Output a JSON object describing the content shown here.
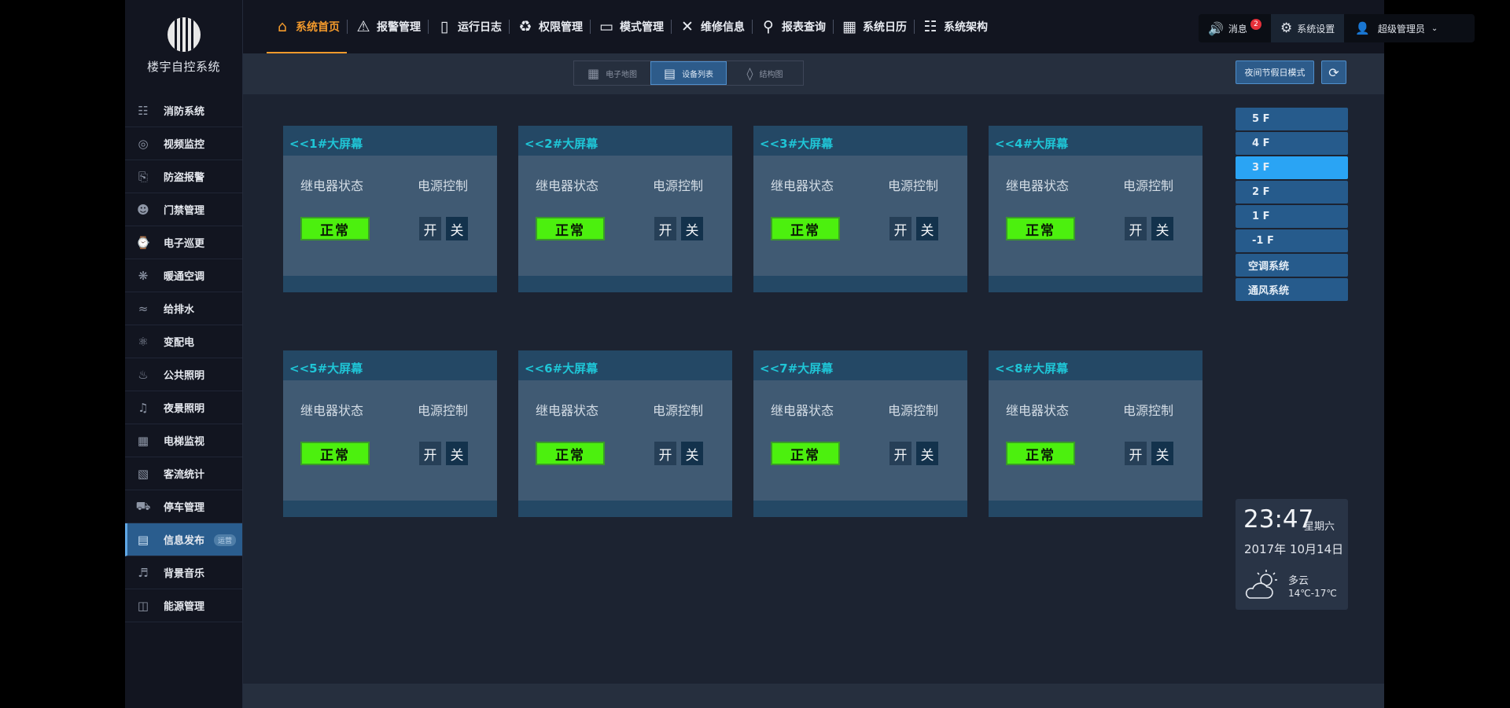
{
  "sidebar": {
    "logo_text": "楼宇自控系统",
    "items": [
      {
        "label": "消防系统",
        "icon": "fire-hydrant-icon"
      },
      {
        "label": "视频监控",
        "icon": "camera-icon"
      },
      {
        "label": "防盗报警",
        "icon": "alarm-vibrate-icon"
      },
      {
        "label": "门禁管理",
        "icon": "access-control-icon"
      },
      {
        "label": "电子巡更",
        "icon": "patrol-watch-icon"
      },
      {
        "label": "暖通空调",
        "icon": "fan-icon"
      },
      {
        "label": "给排水",
        "icon": "water-pipe-icon"
      },
      {
        "label": "变配电",
        "icon": "power-tower-icon"
      },
      {
        "label": "公共照明",
        "icon": "bulb-icon"
      },
      {
        "label": "夜景照明",
        "icon": "street-lamp-icon"
      },
      {
        "label": "电梯监视",
        "icon": "elevator-icon"
      },
      {
        "label": "客流统计",
        "icon": "stats-icon"
      },
      {
        "label": "停车管理",
        "icon": "car-icon"
      },
      {
        "label": "信息发布",
        "icon": "document-icon",
        "badge": "运营"
      },
      {
        "label": "背景音乐",
        "icon": "speaker-icon"
      },
      {
        "label": "能源管理",
        "icon": "briefcase-icon"
      }
    ],
    "active_index": 13
  },
  "topnav": {
    "tabs": [
      {
        "label": "系统首页",
        "icon": "home-icon"
      },
      {
        "label": "报警管理",
        "icon": "warning-icon"
      },
      {
        "label": "运行日志",
        "icon": "log-icon"
      },
      {
        "label": "权限管理",
        "icon": "permission-icon"
      },
      {
        "label": "模式管理",
        "icon": "monitor-icon"
      },
      {
        "label": "维修信息",
        "icon": "tools-icon"
      },
      {
        "label": "报表查询",
        "icon": "search-icon"
      },
      {
        "label": "系统日历",
        "icon": "calendar-icon"
      },
      {
        "label": "系统架构",
        "icon": "org-chart-icon"
      }
    ],
    "active_index": 0
  },
  "topright": {
    "messages_label": "消息",
    "messages_count": "2",
    "settings_label": "系统设置",
    "user_label": "超级管理员"
  },
  "viewswitch": {
    "items": [
      {
        "label": "电子地图",
        "icon": "map-icon"
      },
      {
        "label": "设备列表",
        "icon": "list-icon"
      },
      {
        "label": "结构图",
        "icon": "layers-icon"
      }
    ],
    "active_index": 1
  },
  "holiday_button": "夜间节假日模式",
  "devices": {
    "relay_label": "继电器状态",
    "power_label": "电源控制",
    "on_label": "开",
    "off_label": "关",
    "items": [
      {
        "name": "<<1#大屏幕",
        "status": "正常"
      },
      {
        "name": "<<2#大屏幕",
        "status": "正常"
      },
      {
        "name": "<<3#大屏幕",
        "status": "正常"
      },
      {
        "name": "<<4#大屏幕",
        "status": "正常"
      },
      {
        "name": "<<5#大屏幕",
        "status": "正常"
      },
      {
        "name": "<<6#大屏幕",
        "status": "正常"
      },
      {
        "name": "<<7#大屏幕",
        "status": "正常"
      },
      {
        "name": "<<8#大屏幕",
        "status": "正常"
      }
    ]
  },
  "floors": {
    "items": [
      "5 F",
      "4 F",
      "3 F",
      "2 F",
      "1 F",
      "-1 F",
      "空调系统",
      "通风系统"
    ],
    "active_index": 2
  },
  "weather": {
    "time": "23:47",
    "weekday": "星期六",
    "date": "2017年 10月14日",
    "condition": "多云",
    "temp": "14℃-17℃",
    "icon": "partly-cloudy-icon"
  },
  "colors": {
    "accent": "#f39a2c",
    "status_ok": "#4cf00e",
    "card_title": "#1fc5d6",
    "floor_active": "#2aa4f4",
    "notif_badge": "#e5303a"
  }
}
